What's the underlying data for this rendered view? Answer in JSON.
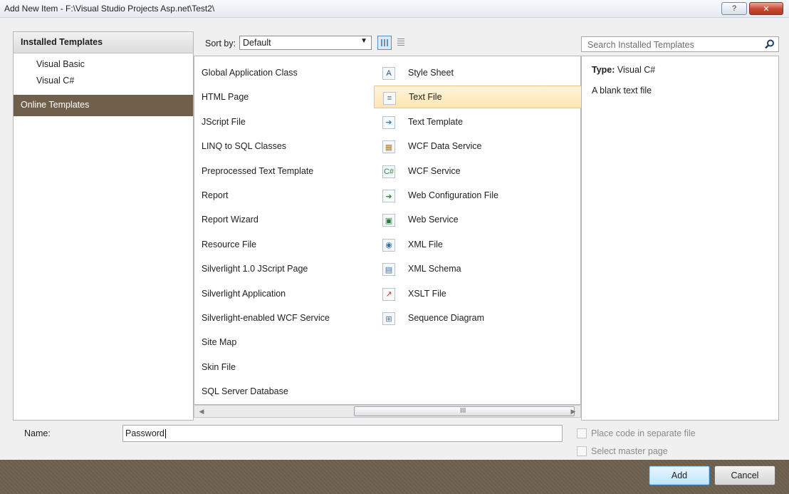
{
  "window": {
    "title": "Add New Item - F:\\Visual Studio Projects Asp.net\\Test2\\",
    "help_glyph": "?",
    "close_glyph": "✕"
  },
  "left_panel": {
    "header": "Installed Templates",
    "tree": [
      "Visual Basic",
      "Visual C#"
    ],
    "online": "Online Templates"
  },
  "toolbar": {
    "sort_label": "Sort by:",
    "sort_value": "Default",
    "sort_arrow": "▼"
  },
  "templates": {
    "left_column": [
      {
        "label": "Global Application Class"
      },
      {
        "label": "HTML Page"
      },
      {
        "label": "JScript File"
      },
      {
        "label": "LINQ to SQL Classes"
      },
      {
        "label": "Preprocessed Text Template"
      },
      {
        "label": "Report"
      },
      {
        "label": "Report Wizard"
      },
      {
        "label": "Resource File"
      },
      {
        "label": "Silverlight 1.0 JScript Page"
      },
      {
        "label": "Silverlight Application"
      },
      {
        "label": "Silverlight-enabled WCF Service"
      },
      {
        "label": "Site Map"
      },
      {
        "label": "Skin File"
      },
      {
        "label": "SQL Server Database"
      }
    ],
    "right_column": [
      {
        "label": "Style Sheet",
        "icon": "style-sheet-icon",
        "glyph": "A",
        "color": "#2a4f8f"
      },
      {
        "label": "Text File",
        "icon": "text-file-icon",
        "glyph": "≡",
        "color": "#4a6f9a",
        "selected": true
      },
      {
        "label": "Text Template",
        "icon": "text-template-icon",
        "glyph": "➜",
        "color": "#3b7fc4"
      },
      {
        "label": "WCF Data Service",
        "icon": "wcf-data-service-icon",
        "glyph": "▦",
        "color": "#c07a2a"
      },
      {
        "label": "WCF Service",
        "icon": "wcf-service-icon",
        "glyph": "C#",
        "color": "#2f8a3a"
      },
      {
        "label": "Web Configuration File",
        "icon": "web-config-icon",
        "glyph": "➜",
        "color": "#2f8a3a"
      },
      {
        "label": "Web Service",
        "icon": "web-service-icon",
        "glyph": "▣",
        "color": "#2f7a3a"
      },
      {
        "label": "XML File",
        "icon": "xml-file-icon",
        "glyph": "◉",
        "color": "#3b6fa4"
      },
      {
        "label": "XML Schema",
        "icon": "xml-schema-icon",
        "glyph": "▤",
        "color": "#3b6fa4"
      },
      {
        "label": "XSLT File",
        "icon": "xslt-file-icon",
        "glyph": "↗",
        "color": "#c0392b"
      },
      {
        "label": "Sequence Diagram",
        "icon": "sequence-diagram-icon",
        "glyph": "⊞",
        "color": "#4a6f9a"
      }
    ]
  },
  "scrollbar": {
    "left": "◀",
    "right": "▶",
    "grip": "III"
  },
  "search": {
    "placeholder": "Search Installed Templates"
  },
  "details": {
    "type_label": "Type:",
    "type_value": "Visual C#",
    "description": "A blank text file"
  },
  "form": {
    "name_label": "Name:",
    "name_value": "Password",
    "opt1": "Place code in separate file",
    "opt2": "Select master page"
  },
  "buttons": {
    "add": "Add",
    "cancel": "Cancel"
  }
}
